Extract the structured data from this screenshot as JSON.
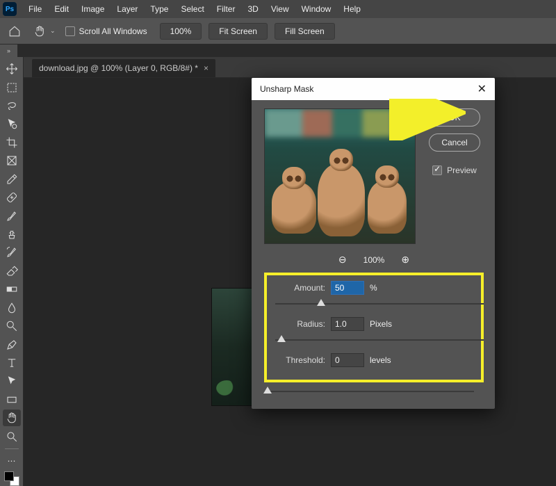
{
  "menu": {
    "items": [
      "File",
      "Edit",
      "Image",
      "Layer",
      "Type",
      "Select",
      "Filter",
      "3D",
      "View",
      "Window",
      "Help"
    ]
  },
  "options": {
    "scroll_all_label": "Scroll All Windows",
    "zoom_value": "100%",
    "fit_label": "Fit Screen",
    "fill_label": "Fill Screen"
  },
  "document": {
    "tab_title": "download.jpg @ 100% (Layer 0, RGB/8#) *"
  },
  "dialog": {
    "title": "Unsharp Mask",
    "ok_label": "OK",
    "cancel_label": "Cancel",
    "preview_label": "Preview",
    "preview_checked": true,
    "zoom_value": "100%",
    "amount": {
      "label": "Amount:",
      "value": "50",
      "unit": "%",
      "slider_pct": 22
    },
    "radius": {
      "label": "Radius:",
      "value": "1.0",
      "unit": "Pixels",
      "slider_pct": 3
    },
    "threshold": {
      "label": "Threshold:",
      "value": "0",
      "unit": "levels",
      "slider_pct": 1
    }
  },
  "tool_names": [
    "move",
    "marquee",
    "lasso",
    "quick-select",
    "crop",
    "frame",
    "eyedropper",
    "healing",
    "brush",
    "clone",
    "history-brush",
    "eraser",
    "gradient",
    "blur",
    "dodge",
    "pen",
    "type",
    "path-select",
    "rectangle",
    "hand",
    "zoom"
  ]
}
